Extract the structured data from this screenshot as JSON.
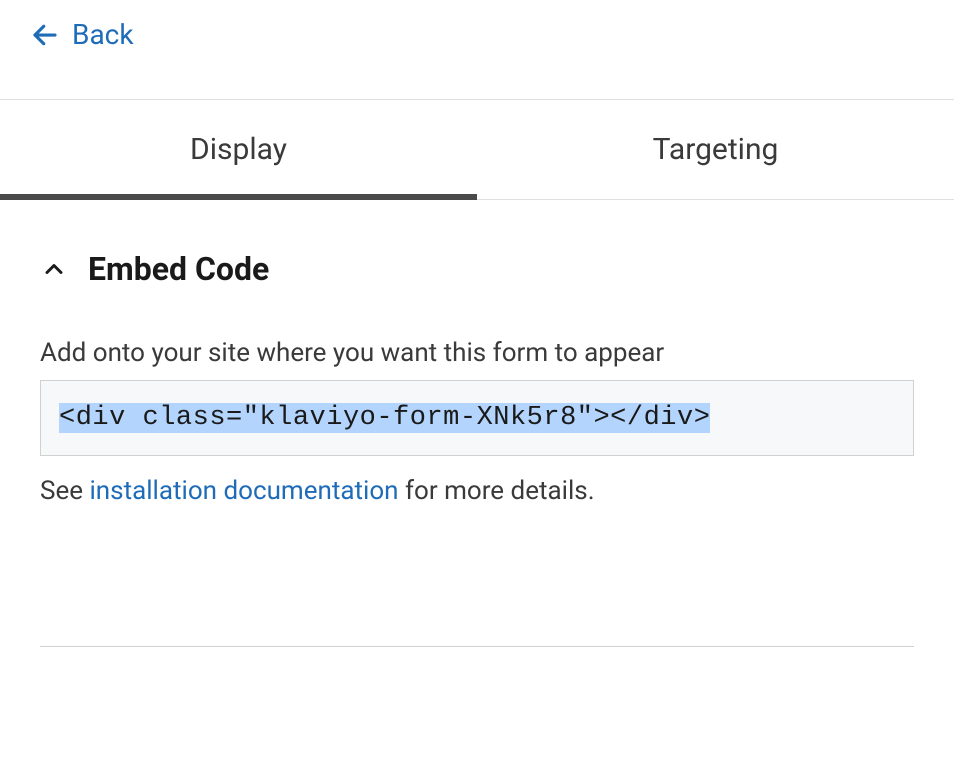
{
  "back": {
    "label": "Back"
  },
  "tabs": {
    "display": "Display",
    "targeting": "Targeting"
  },
  "embed": {
    "title": "Embed Code",
    "instruction": "Add onto your site where you want this form to appear",
    "code": "<div class=\"klaviyo-form-XNk5r8\"></div>",
    "help_prefix": "See ",
    "help_link": "installation documentation",
    "help_suffix": " for more details."
  }
}
